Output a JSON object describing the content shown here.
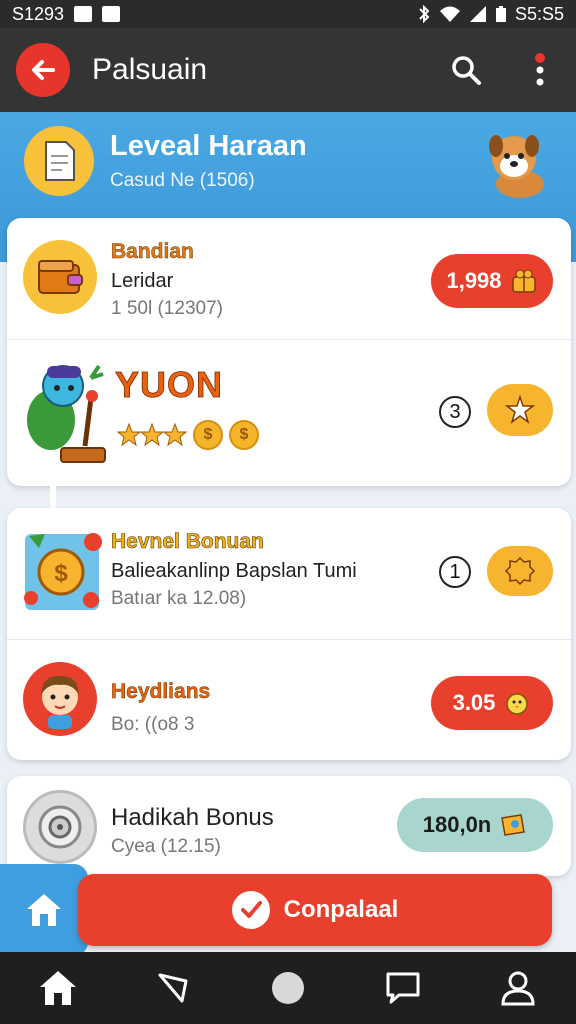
{
  "statusbar": {
    "time_left": "S1293",
    "time_right": "S5:S5"
  },
  "appbar": {
    "title": "Palsuain"
  },
  "banner": {
    "title": "Leveal Haraan",
    "subtitle": "Casud Ne (1506)"
  },
  "card1": {
    "rows": [
      {
        "title": "Bandian",
        "line2": "Leridar",
        "line3": "1 50l (12307)",
        "value": "1,998"
      },
      {
        "title": "YUON",
        "number": "3"
      }
    ]
  },
  "card2": {
    "rows": [
      {
        "title": "Hevnel Bonuan",
        "line2": "Balieakanlinp Bapslan Tumi",
        "line3": "Batıar ka 12.08)",
        "number": "1"
      },
      {
        "title": "Heydlians",
        "line2": "Bo: ((o8 3",
        "value": "3.05"
      }
    ]
  },
  "card3": {
    "rows": [
      {
        "title": "Hadikah Bonus",
        "line2": "Cyea (12.15)",
        "value": "180,0n"
      }
    ]
  },
  "cta": {
    "label": "Conpalaal"
  },
  "colors": {
    "accent_red": "#e8402c",
    "accent_blue": "#3f9ee0",
    "accent_orange": "#f6b42f",
    "teal_pill": "#a8d6cf"
  }
}
